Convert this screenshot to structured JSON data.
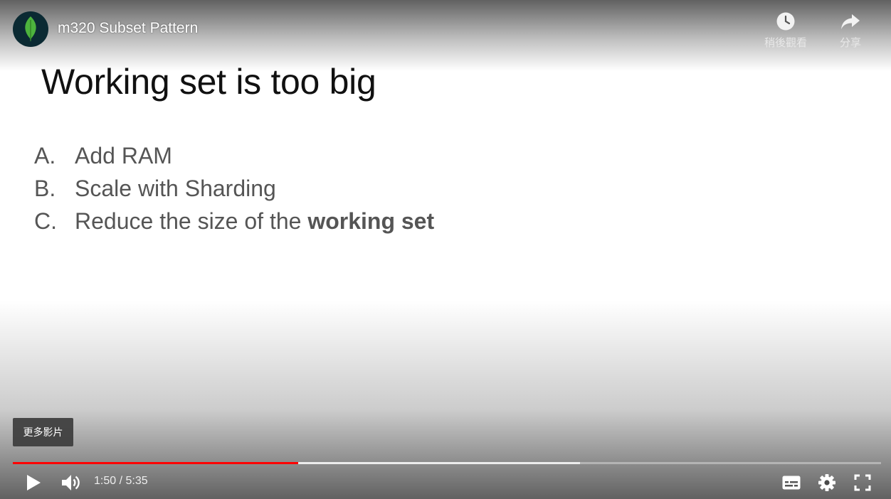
{
  "header": {
    "channel_logo": "mongodb-leaf-icon",
    "video_title": "m320 Subset Pattern",
    "watch_later_label": "稍後觀看",
    "share_label": "分享"
  },
  "slide": {
    "title": "Working set is too big",
    "items": [
      {
        "letter": "A.",
        "text": "Add RAM",
        "bold": ""
      },
      {
        "letter": "B.",
        "text": "Scale with Sharding",
        "bold": ""
      },
      {
        "letter": "C.",
        "text": "Reduce the size of the ",
        "bold": "working set"
      }
    ]
  },
  "more_videos_label": "更多影片",
  "player": {
    "current_time": "1:50",
    "separator": " / ",
    "duration": "5:35",
    "progress_fraction": 0.329,
    "buffered_fraction": 0.653,
    "progress_color": "#ff0000"
  },
  "icons": {
    "play": "play-icon",
    "volume": "volume-icon",
    "subtitles": "subtitles-icon",
    "settings": "gear-icon",
    "fullscreen": "fullscreen-icon",
    "watch_later": "clock-icon",
    "share": "share-arrow-icon"
  }
}
